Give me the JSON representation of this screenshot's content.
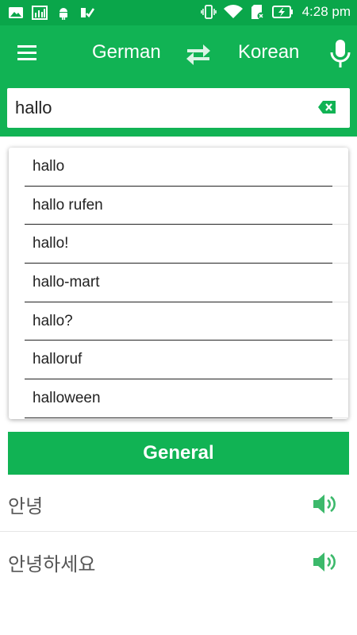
{
  "status_bar": {
    "time": "4:28 pm",
    "left_icons": [
      "gallery-icon",
      "chart-icon",
      "android-icon",
      "check-icon"
    ],
    "right_icons": [
      "vibrate-icon",
      "wifi-icon",
      "sdcard-icon",
      "battery-charging-icon"
    ]
  },
  "app_bar": {
    "source_language": "German",
    "target_language": "Korean",
    "menu_icon": "menu-icon",
    "swap_icon": "swap-icon",
    "mic_icon": "mic-icon"
  },
  "search": {
    "value": "hallo",
    "clear_icon": "backspace-icon"
  },
  "suggestions": [
    "hallo",
    "hallo rufen",
    "hallo!",
    "hallo-mart",
    "hallo?",
    "halloruf",
    "halloween"
  ],
  "section": {
    "title": "General"
  },
  "results": [
    {
      "text": "안녕",
      "icon": "speaker-icon"
    },
    {
      "text": "안녕하세요",
      "icon": "speaker-icon"
    }
  ],
  "colors": {
    "status_bar": "#0aa64a",
    "primary": "#11b354",
    "speaker": "#3cb96b",
    "clear": "#11b354"
  }
}
